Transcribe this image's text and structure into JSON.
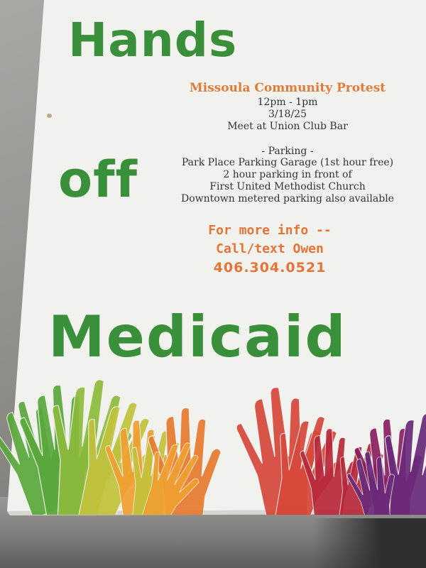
{
  "flyer": {
    "headline_word1": "Hands",
    "headline_word2": "off",
    "headline_word3": "Medicaid",
    "event_title": "Missoula Community Protest",
    "time": "12pm - 1pm",
    "date": "3/18/25",
    "meeting_place": "Meet at Union Club Bar",
    "parking_heading": "- Parking -",
    "parking_lines": [
      "Park Place Parking Garage (1st hour free)",
      "2 hour parking in front of",
      "First United Methodist Church",
      "Downtown metered parking also available"
    ],
    "contact_line1": "For more info --",
    "contact_line2": "Call/text Owen",
    "phone": "406.304.0521"
  },
  "colors": {
    "headline": "#3a8f3a",
    "accent_orange": "#e67436",
    "body_text": "#333333",
    "paper": "#f1f1ee"
  },
  "illustration": {
    "hand_colors": [
      "#5aa83a",
      "#8dbb3c",
      "#c2c23a",
      "#f0a030",
      "#e87a30",
      "#d8473a",
      "#b8283a",
      "#8a2060",
      "#6a2a7a"
    ]
  }
}
